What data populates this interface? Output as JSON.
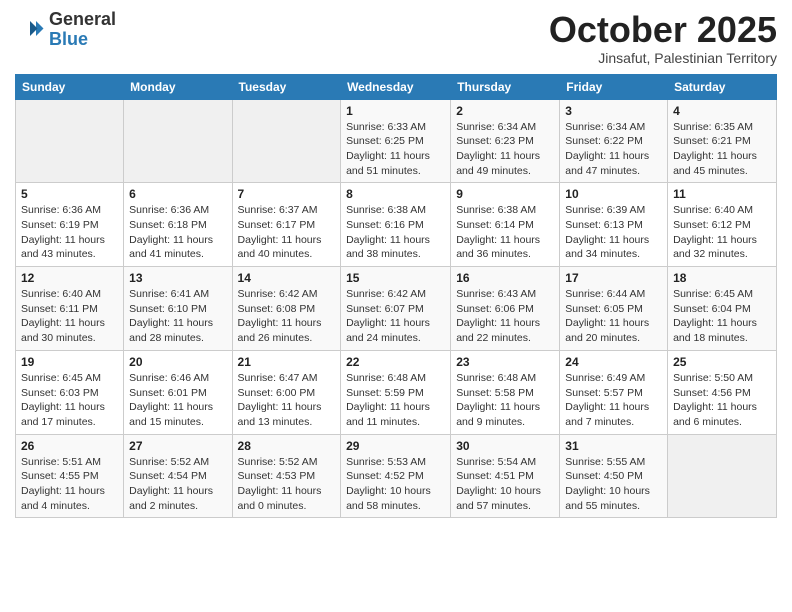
{
  "header": {
    "logo_general": "General",
    "logo_blue": "Blue",
    "month_title": "October 2025",
    "subtitle": "Jinsafut, Palestinian Territory"
  },
  "days_of_week": [
    "Sunday",
    "Monday",
    "Tuesday",
    "Wednesday",
    "Thursday",
    "Friday",
    "Saturday"
  ],
  "weeks": [
    [
      {
        "day": "",
        "info": ""
      },
      {
        "day": "",
        "info": ""
      },
      {
        "day": "",
        "info": ""
      },
      {
        "day": "1",
        "info": "Sunrise: 6:33 AM\nSunset: 6:25 PM\nDaylight: 11 hours\nand 51 minutes."
      },
      {
        "day": "2",
        "info": "Sunrise: 6:34 AM\nSunset: 6:23 PM\nDaylight: 11 hours\nand 49 minutes."
      },
      {
        "day": "3",
        "info": "Sunrise: 6:34 AM\nSunset: 6:22 PM\nDaylight: 11 hours\nand 47 minutes."
      },
      {
        "day": "4",
        "info": "Sunrise: 6:35 AM\nSunset: 6:21 PM\nDaylight: 11 hours\nand 45 minutes."
      }
    ],
    [
      {
        "day": "5",
        "info": "Sunrise: 6:36 AM\nSunset: 6:19 PM\nDaylight: 11 hours\nand 43 minutes."
      },
      {
        "day": "6",
        "info": "Sunrise: 6:36 AM\nSunset: 6:18 PM\nDaylight: 11 hours\nand 41 minutes."
      },
      {
        "day": "7",
        "info": "Sunrise: 6:37 AM\nSunset: 6:17 PM\nDaylight: 11 hours\nand 40 minutes."
      },
      {
        "day": "8",
        "info": "Sunrise: 6:38 AM\nSunset: 6:16 PM\nDaylight: 11 hours\nand 38 minutes."
      },
      {
        "day": "9",
        "info": "Sunrise: 6:38 AM\nSunset: 6:14 PM\nDaylight: 11 hours\nand 36 minutes."
      },
      {
        "day": "10",
        "info": "Sunrise: 6:39 AM\nSunset: 6:13 PM\nDaylight: 11 hours\nand 34 minutes."
      },
      {
        "day": "11",
        "info": "Sunrise: 6:40 AM\nSunset: 6:12 PM\nDaylight: 11 hours\nand 32 minutes."
      }
    ],
    [
      {
        "day": "12",
        "info": "Sunrise: 6:40 AM\nSunset: 6:11 PM\nDaylight: 11 hours\nand 30 minutes."
      },
      {
        "day": "13",
        "info": "Sunrise: 6:41 AM\nSunset: 6:10 PM\nDaylight: 11 hours\nand 28 minutes."
      },
      {
        "day": "14",
        "info": "Sunrise: 6:42 AM\nSunset: 6:08 PM\nDaylight: 11 hours\nand 26 minutes."
      },
      {
        "day": "15",
        "info": "Sunrise: 6:42 AM\nSunset: 6:07 PM\nDaylight: 11 hours\nand 24 minutes."
      },
      {
        "day": "16",
        "info": "Sunrise: 6:43 AM\nSunset: 6:06 PM\nDaylight: 11 hours\nand 22 minutes."
      },
      {
        "day": "17",
        "info": "Sunrise: 6:44 AM\nSunset: 6:05 PM\nDaylight: 11 hours\nand 20 minutes."
      },
      {
        "day": "18",
        "info": "Sunrise: 6:45 AM\nSunset: 6:04 PM\nDaylight: 11 hours\nand 18 minutes."
      }
    ],
    [
      {
        "day": "19",
        "info": "Sunrise: 6:45 AM\nSunset: 6:03 PM\nDaylight: 11 hours\nand 17 minutes."
      },
      {
        "day": "20",
        "info": "Sunrise: 6:46 AM\nSunset: 6:01 PM\nDaylight: 11 hours\nand 15 minutes."
      },
      {
        "day": "21",
        "info": "Sunrise: 6:47 AM\nSunset: 6:00 PM\nDaylight: 11 hours\nand 13 minutes."
      },
      {
        "day": "22",
        "info": "Sunrise: 6:48 AM\nSunset: 5:59 PM\nDaylight: 11 hours\nand 11 minutes."
      },
      {
        "day": "23",
        "info": "Sunrise: 6:48 AM\nSunset: 5:58 PM\nDaylight: 11 hours\nand 9 minutes."
      },
      {
        "day": "24",
        "info": "Sunrise: 6:49 AM\nSunset: 5:57 PM\nDaylight: 11 hours\nand 7 minutes."
      },
      {
        "day": "25",
        "info": "Sunrise: 5:50 AM\nSunset: 4:56 PM\nDaylight: 11 hours\nand 6 minutes."
      }
    ],
    [
      {
        "day": "26",
        "info": "Sunrise: 5:51 AM\nSunset: 4:55 PM\nDaylight: 11 hours\nand 4 minutes."
      },
      {
        "day": "27",
        "info": "Sunrise: 5:52 AM\nSunset: 4:54 PM\nDaylight: 11 hours\nand 2 minutes."
      },
      {
        "day": "28",
        "info": "Sunrise: 5:52 AM\nSunset: 4:53 PM\nDaylight: 11 hours\nand 0 minutes."
      },
      {
        "day": "29",
        "info": "Sunrise: 5:53 AM\nSunset: 4:52 PM\nDaylight: 10 hours\nand 58 minutes."
      },
      {
        "day": "30",
        "info": "Sunrise: 5:54 AM\nSunset: 4:51 PM\nDaylight: 10 hours\nand 57 minutes."
      },
      {
        "day": "31",
        "info": "Sunrise: 5:55 AM\nSunset: 4:50 PM\nDaylight: 10 hours\nand 55 minutes."
      },
      {
        "day": "",
        "info": ""
      }
    ]
  ]
}
